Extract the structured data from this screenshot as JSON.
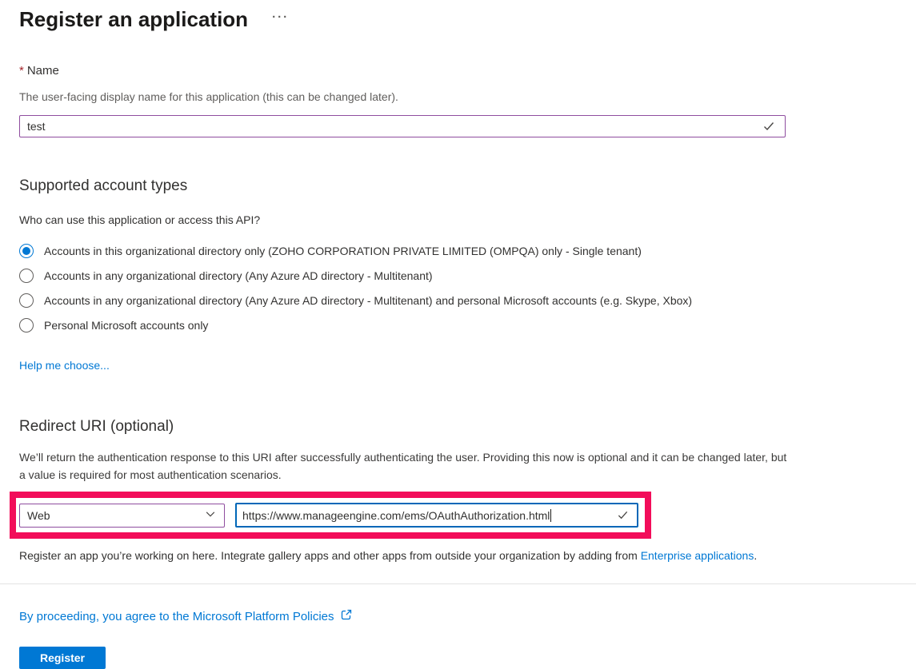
{
  "page": {
    "title": "Register an application",
    "title_more_glyph": "···"
  },
  "name_section": {
    "required_marker": "*",
    "label": "Name",
    "description": "The user-facing display name for this application (this can be changed later).",
    "input_value": "test"
  },
  "account_types_section": {
    "heading": "Supported account types",
    "question": "Who can use this application or access this API?",
    "options": [
      {
        "label": "Accounts in this organizational directory only (ZOHO CORPORATION PRIVATE LIMITED (OMPQA) only - Single tenant)",
        "selected": true
      },
      {
        "label": "Accounts in any organizational directory (Any Azure AD directory - Multitenant)",
        "selected": false
      },
      {
        "label": "Accounts in any organizational directory (Any Azure AD directory - Multitenant) and personal Microsoft accounts (e.g. Skype, Xbox)",
        "selected": false
      },
      {
        "label": "Personal Microsoft accounts only",
        "selected": false
      }
    ],
    "help_link": "Help me choose..."
  },
  "redirect_section": {
    "heading": "Redirect URI (optional)",
    "description": "We’ll return the authentication response to this URI after successfully authenticating the user. Providing this now is optional and it can be changed later, but a value is required for most authentication scenarios.",
    "platform_selected": "Web",
    "uri_value": "https://www.manageengine.com/ems/OAuthAuthorization.html",
    "note_prefix": "Register an app you’re working on here. Integrate gallery apps and other apps from outside your organization by adding from ",
    "note_link": "Enterprise applications",
    "note_suffix": "."
  },
  "footer": {
    "policy_text": "By proceeding, you agree to the Microsoft Platform Policies",
    "register_button": "Register"
  },
  "icons": {
    "name_field_valid": "checkmark",
    "uri_field_valid": "checkmark",
    "platform_dropdown": "chevron-down",
    "policy_link": "external-link",
    "title_more": "ellipsis"
  },
  "colors": {
    "accent_blue": "#0078d4",
    "focused_input_border": "#0067b8",
    "input_border_purple": "#8f4d9f",
    "annotation_highlight_red": "#f20d5a",
    "required_red": "#a4262c",
    "text_dark": "#323130",
    "text_gray": "#605e5c"
  }
}
